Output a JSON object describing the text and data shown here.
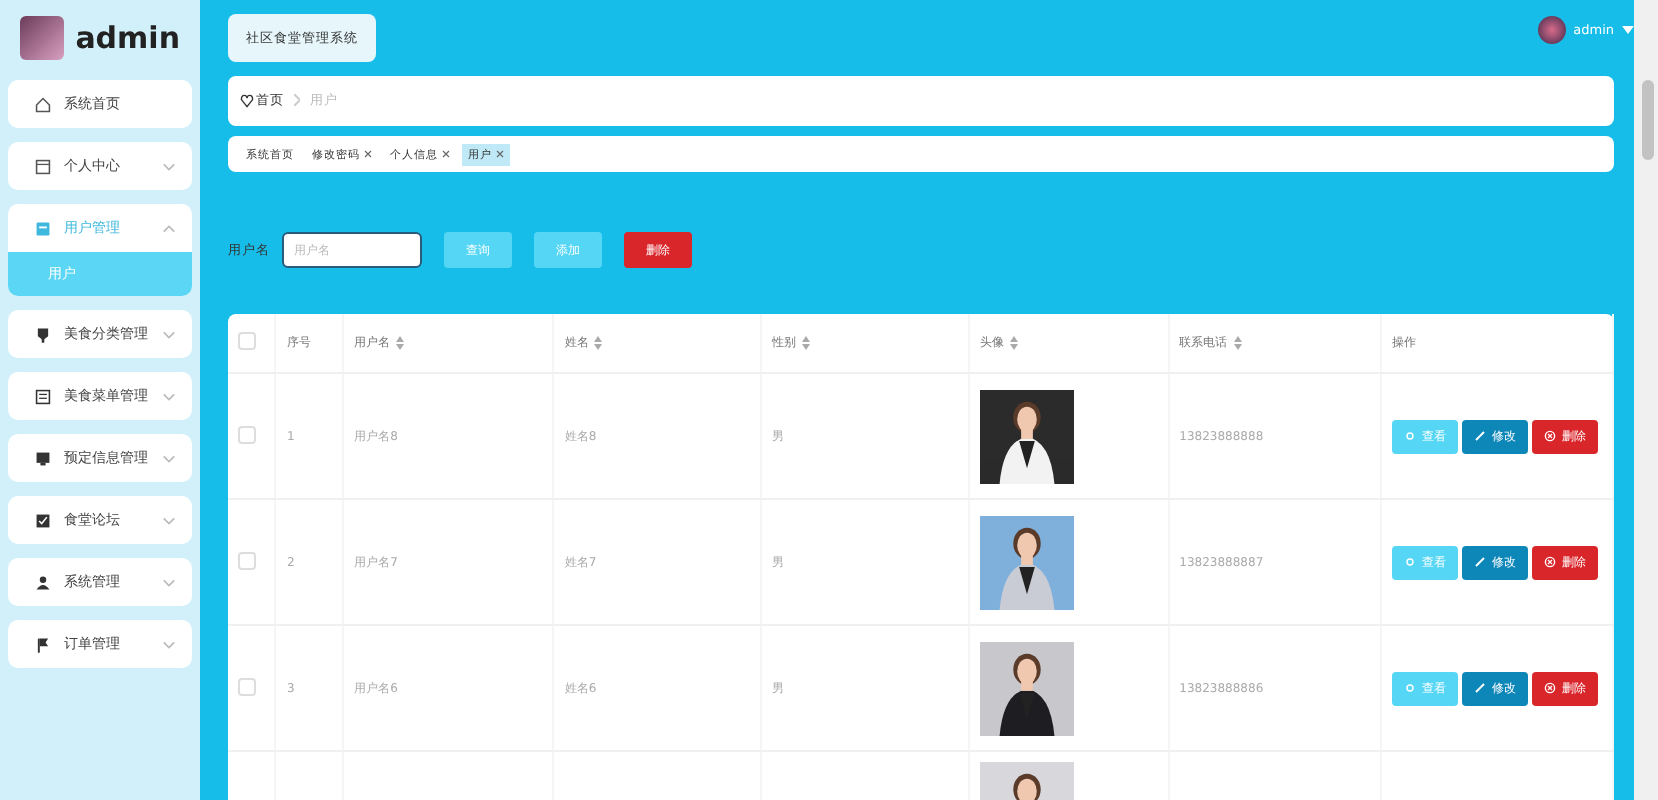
{
  "sidebar": {
    "user": "admin",
    "items": [
      {
        "label": "系统首页",
        "selected": false
      },
      {
        "label": "个人中心",
        "selected": false,
        "expanded": false
      },
      {
        "label": "用户管理",
        "selected": true,
        "expanded": true,
        "children": [
          {
            "label": "用户",
            "selected": true
          }
        ]
      },
      {
        "label": "美食分类管理",
        "selected": false,
        "expanded": false
      },
      {
        "label": "美食菜单管理",
        "selected": false,
        "expanded": false
      },
      {
        "label": "预定信息管理",
        "selected": false,
        "expanded": false
      },
      {
        "label": "食堂论坛",
        "selected": false,
        "expanded": false
      },
      {
        "label": "系统管理",
        "selected": false,
        "expanded": false
      },
      {
        "label": "订单管理",
        "selected": false,
        "expanded": false
      }
    ]
  },
  "header": {
    "title": "社区食堂管理系统",
    "user": "admin"
  },
  "breadcrumb": [
    "首页",
    "用户"
  ],
  "tabs": [
    {
      "label": "系统首页",
      "closable": false,
      "selected": false
    },
    {
      "label": "修改密码",
      "closable": true,
      "selected": false
    },
    {
      "label": "个人信息",
      "closable": true,
      "selected": false
    },
    {
      "label": "用户",
      "closable": true,
      "selected": true
    }
  ],
  "search": {
    "label": "用户名",
    "placeholder": "用户名",
    "buttons": [
      {
        "label": "查询",
        "kind": "query"
      },
      {
        "label": "添加",
        "kind": "add"
      },
      {
        "label": "删除",
        "kind": "delete"
      }
    ]
  },
  "table": {
    "select_all": {
      "checked": false
    },
    "columns": [
      {
        "label": "序号",
        "sortable": false
      },
      {
        "label": "用户名",
        "sortable": true
      },
      {
        "label": "姓名",
        "sortable": true
      },
      {
        "label": "性别",
        "sortable": true
      },
      {
        "label": "头像",
        "sortable": true
      },
      {
        "label": "联系电话",
        "sortable": true
      },
      {
        "label": "操作",
        "sortable": false
      }
    ],
    "rows": [
      {
        "checked": false,
        "cells": [
          "1",
          "用户名8",
          "姓名8",
          "男"
        ],
        "photo": {
          "kind": "picture"
        },
        "phone": "13823888888",
        "actions": [
          {
            "label": "查看",
            "kind": "view"
          },
          {
            "label": "修改",
            "kind": "edit"
          },
          {
            "label": "删除",
            "kind": "delete"
          }
        ]
      },
      {
        "checked": false,
        "cells": [
          "2",
          "用户名7",
          "姓名7",
          "男"
        ],
        "photo": {
          "kind": "picture"
        },
        "phone": "13823888887",
        "actions": [
          {
            "label": "查看",
            "kind": "view"
          },
          {
            "label": "修改",
            "kind": "edit"
          },
          {
            "label": "删除",
            "kind": "delete"
          }
        ]
      },
      {
        "checked": false,
        "cells": [
          "3",
          "用户名6",
          "姓名6",
          "男"
        ],
        "photo": {
          "kind": "picture"
        },
        "phone": "13823888886",
        "actions": [
          {
            "label": "查看",
            "kind": "view"
          },
          {
            "label": "修改",
            "kind": "edit"
          },
          {
            "label": "删除",
            "kind": "delete"
          }
        ]
      },
      {
        "photo": {
          "kind": "picture"
        }
      }
    ]
  }
}
